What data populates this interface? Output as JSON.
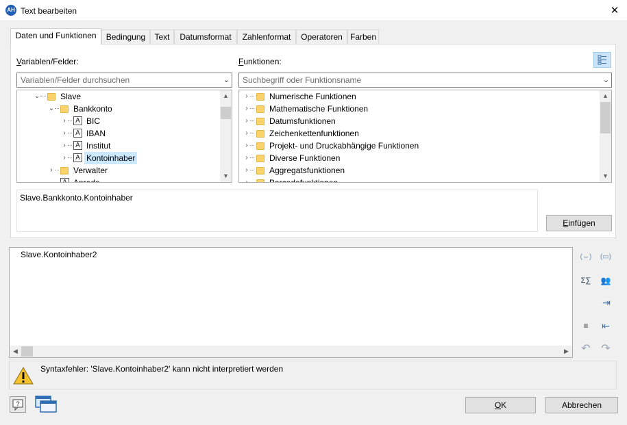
{
  "window": {
    "title": "Text bearbeiten",
    "app_icon_text": "AH",
    "close_glyph": "✕"
  },
  "tabs": [
    {
      "label": "Daten und Funktionen",
      "active": true
    },
    {
      "label": "Bedingung"
    },
    {
      "label": "Text"
    },
    {
      "label": "Datumsformat"
    },
    {
      "label": "Zahlenformat"
    },
    {
      "label": "Operatoren"
    },
    {
      "label": "Farben"
    }
  ],
  "variables": {
    "label_accel": "V",
    "label_rest": "ariablen/Felder:",
    "search_placeholder": "Variablen/Felder durchsuchen",
    "tree": [
      {
        "text": "Slave",
        "icon": "folder",
        "expander": "⌄",
        "level": 0
      },
      {
        "text": "Bankkonto",
        "icon": "folder",
        "expander": "⌄",
        "level": 1
      },
      {
        "text": "BIC",
        "icon": "field",
        "expander": "›",
        "level": 2
      },
      {
        "text": "IBAN",
        "icon": "field",
        "expander": "›",
        "level": 2
      },
      {
        "text": "Institut",
        "icon": "field",
        "expander": "›",
        "level": 2
      },
      {
        "text": "Kontoinhaber",
        "icon": "field",
        "expander": "›",
        "level": 2,
        "selected": true
      },
      {
        "text": "Verwalter",
        "icon": "folder",
        "expander": "›",
        "level": 1
      },
      {
        "text": "Anrede",
        "icon": "field",
        "expander": "",
        "level": 1
      }
    ]
  },
  "functions": {
    "label_accel": "F",
    "label_rest": "unktionen:",
    "search_placeholder": "Suchbegriff oder Funktionsname",
    "tree": [
      {
        "text": "Numerische Funktionen"
      },
      {
        "text": "Mathematische Funktionen"
      },
      {
        "text": "Datumsfunktionen"
      },
      {
        "text": "Zeichenkettenfunktionen"
      },
      {
        "text": "Projekt- und Druckabhängige Funktionen"
      },
      {
        "text": "Diverse Funktionen"
      },
      {
        "text": "Aggregatsfunktionen"
      },
      {
        "text": "Barcodefunktionen"
      }
    ]
  },
  "preview": {
    "text": "Slave.Bankkonto.Kontoinhaber"
  },
  "insert_button": {
    "accel": "E",
    "rest": "infügen"
  },
  "expression_editor": {
    "text": "Slave.Kontoinhaber2"
  },
  "error": {
    "message": "Syntaxfehler: 'Slave.Kontoinhaber2' kann nicht interpretiert werden"
  },
  "footer": {
    "ok_accel": "O",
    "ok_rest": "K",
    "cancel_label": "Abbrechen"
  },
  "side_icons": [
    {
      "name": "wrap-parentheses-icon",
      "glyph": "(⇔)"
    },
    {
      "name": "insert-field-icon",
      "glyph": "(▭)"
    },
    {
      "name": "sum-icon",
      "glyph": "Σ∑"
    },
    {
      "name": "users-icon",
      "glyph": "👥"
    },
    {
      "name": "format-icon",
      "glyph": "⇥"
    },
    {
      "name": "indent-icon",
      "glyph": "≡"
    },
    {
      "name": "outdent-icon",
      "glyph": "⇤"
    },
    {
      "name": "undo-icon",
      "glyph": "↶"
    },
    {
      "name": "redo-icon",
      "glyph": "↷"
    }
  ],
  "colors": {
    "selection": "#cce8ff",
    "folder": "#fcd36b",
    "accent": "#1e5fb4"
  }
}
